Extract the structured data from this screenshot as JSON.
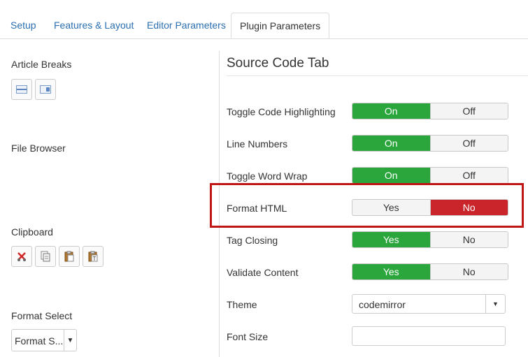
{
  "tabs": [
    {
      "label": "Setup"
    },
    {
      "label": "Features & Layout"
    },
    {
      "label": "Editor Parameters"
    },
    {
      "label": "Plugin Parameters"
    }
  ],
  "left": {
    "article_breaks": "Article Breaks",
    "file_browser": "File Browser",
    "clipboard": "Clipboard",
    "format_select": "Format Select",
    "format_select_value": "Format S..."
  },
  "section": {
    "title": "Source Code Tab",
    "rows": [
      {
        "label": "Toggle Code Highlighting",
        "opt1": "On",
        "opt2": "Off"
      },
      {
        "label": "Line Numbers",
        "opt1": "On",
        "opt2": "Off"
      },
      {
        "label": "Toggle Word Wrap",
        "opt1": "On",
        "opt2": "Off"
      },
      {
        "label": "Format HTML",
        "opt1": "Yes",
        "opt2": "No"
      },
      {
        "label": "Tag Closing",
        "opt1": "Yes",
        "opt2": "No"
      },
      {
        "label": "Validate Content",
        "opt1": "Yes",
        "opt2": "No"
      }
    ],
    "theme_label": "Theme",
    "theme_value": "codemirror",
    "font_size_label": "Font Size",
    "font_size_value": ""
  },
  "colors": {
    "accent": "#2a6fb1",
    "green": "#2aa63c",
    "red": "#c9252b",
    "highlight": "#bf1515"
  }
}
